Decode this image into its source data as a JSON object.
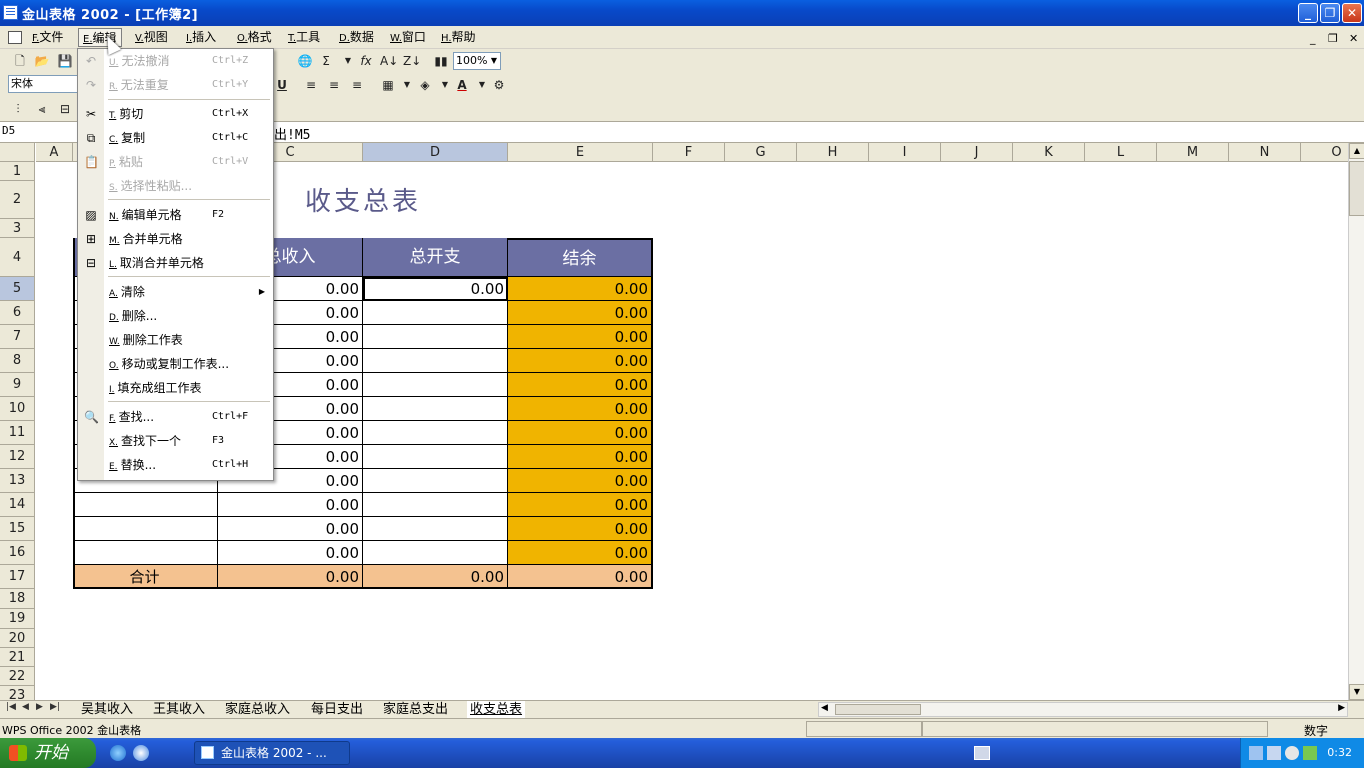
{
  "window": {
    "title": "金山表格  2002 - [工作簿2]"
  },
  "menubar": [
    {
      "acc": "F.",
      "label": "文件"
    },
    {
      "acc": "E.",
      "label": "编辑"
    },
    {
      "acc": "V.",
      "label": "视图"
    },
    {
      "acc": "I.",
      "label": "插入"
    },
    {
      "acc": "O.",
      "label": "格式"
    },
    {
      "acc": "T.",
      "label": "工具"
    },
    {
      "acc": "D.",
      "label": "数据"
    },
    {
      "acc": "W.",
      "label": "窗口"
    },
    {
      "acc": "H.",
      "label": "帮助"
    }
  ],
  "toolbar": {
    "font_name": "宋体",
    "zoom": "100%"
  },
  "formula_bar": {
    "name_box": "D5",
    "formula": "出!M5"
  },
  "columns": [
    "A",
    "C",
    "D",
    "E",
    "F",
    "G",
    "H",
    "I",
    "J",
    "K",
    "L",
    "M",
    "N",
    "O"
  ],
  "rows": [
    "1",
    "2",
    "3",
    "4",
    "5",
    "6",
    "7",
    "8",
    "9",
    "10",
    "11",
    "12",
    "13",
    "14",
    "15",
    "16",
    "17",
    "18",
    "19",
    "20",
    "21",
    "22",
    "23"
  ],
  "sheet": {
    "title": "收支总表",
    "headers": {
      "c": "总收入",
      "d": "总开支",
      "e": "结余"
    },
    "data_rows": [
      {
        "c": "0.00",
        "d": "0.00",
        "e": "0.00"
      },
      {
        "c": "0.00",
        "d": "",
        "e": "0.00"
      },
      {
        "c": "0.00",
        "d": "",
        "e": "0.00"
      },
      {
        "c": "0.00",
        "d": "",
        "e": "0.00"
      },
      {
        "c": "0.00",
        "d": "",
        "e": "0.00"
      },
      {
        "c": "0.00",
        "d": "",
        "e": "0.00"
      },
      {
        "c": "0.00",
        "d": "",
        "e": "0.00"
      },
      {
        "c": "0.00",
        "d": "",
        "e": "0.00"
      },
      {
        "c": "0.00",
        "d": "",
        "e": "0.00"
      },
      {
        "c": "0.00",
        "d": "",
        "e": "0.00"
      },
      {
        "c": "0.00",
        "d": "",
        "e": "0.00"
      },
      {
        "c": "0.00",
        "d": "",
        "e": "0.00"
      }
    ],
    "total": {
      "label": "合计",
      "c": "0.00",
      "d": "0.00",
      "e": "0.00"
    }
  },
  "edit_menu": {
    "items": [
      {
        "acc": "U.",
        "label": "无法撤消",
        "shortcut": "Ctrl+Z",
        "disabled": true,
        "icon": "undo-icon"
      },
      {
        "acc": "R.",
        "label": "无法重复",
        "shortcut": "Ctrl+Y",
        "disabled": true,
        "icon": "redo-icon"
      },
      {
        "acc": "T.",
        "label": "剪切",
        "shortcut": "Ctrl+X",
        "disabled": false,
        "icon": "scissors-icon"
      },
      {
        "acc": "C.",
        "label": "复制",
        "shortcut": "Ctrl+C",
        "disabled": false,
        "icon": "copy-icon"
      },
      {
        "acc": "P.",
        "label": "粘贴",
        "shortcut": "Ctrl+V",
        "disabled": true,
        "icon": "paste-icon"
      },
      {
        "acc": "S.",
        "label": "选择性粘贴...",
        "shortcut": "",
        "disabled": true,
        "icon": ""
      },
      {
        "acc": "N.",
        "label": "编辑单元格",
        "shortcut": "F2",
        "disabled": false,
        "icon": "edit-cell-icon"
      },
      {
        "acc": "M.",
        "label": "合并单元格",
        "shortcut": "",
        "disabled": false,
        "icon": "merge-cells-icon"
      },
      {
        "acc": "L.",
        "label": "取消合并单元格",
        "shortcut": "",
        "disabled": false,
        "icon": "unmerge-cells-icon"
      },
      {
        "acc": "A.",
        "label": "清除",
        "shortcut": "",
        "disabled": false,
        "icon": "",
        "submenu": true
      },
      {
        "acc": "D.",
        "label": "删除...",
        "shortcut": "",
        "disabled": false,
        "icon": ""
      },
      {
        "acc": "W.",
        "label": "删除工作表",
        "shortcut": "",
        "disabled": false,
        "icon": ""
      },
      {
        "acc": "O.",
        "label": "移动或复制工作表...",
        "shortcut": "",
        "disabled": false,
        "icon": ""
      },
      {
        "acc": "I.",
        "label": "填充成组工作表",
        "shortcut": "",
        "disabled": false,
        "icon": ""
      },
      {
        "acc": "F.",
        "label": "查找...",
        "shortcut": "Ctrl+F",
        "disabled": false,
        "icon": "binoculars-icon"
      },
      {
        "acc": "X.",
        "label": "查找下一个",
        "shortcut": "F3",
        "disabled": false,
        "icon": ""
      },
      {
        "acc": "E.",
        "label": "替换...",
        "shortcut": "Ctrl+H",
        "disabled": false,
        "icon": ""
      }
    ]
  },
  "sheet_tabs": [
    "吴其收入",
    "王其收入",
    "家庭总收入",
    "每日支出",
    "家庭总支出",
    "收支总表"
  ],
  "status": {
    "text": "WPS Office 2002 金山表格",
    "mode": "数字"
  },
  "taskbar": {
    "start": "开始",
    "task": "金山表格 2002 - ...",
    "clock": "0:32"
  }
}
